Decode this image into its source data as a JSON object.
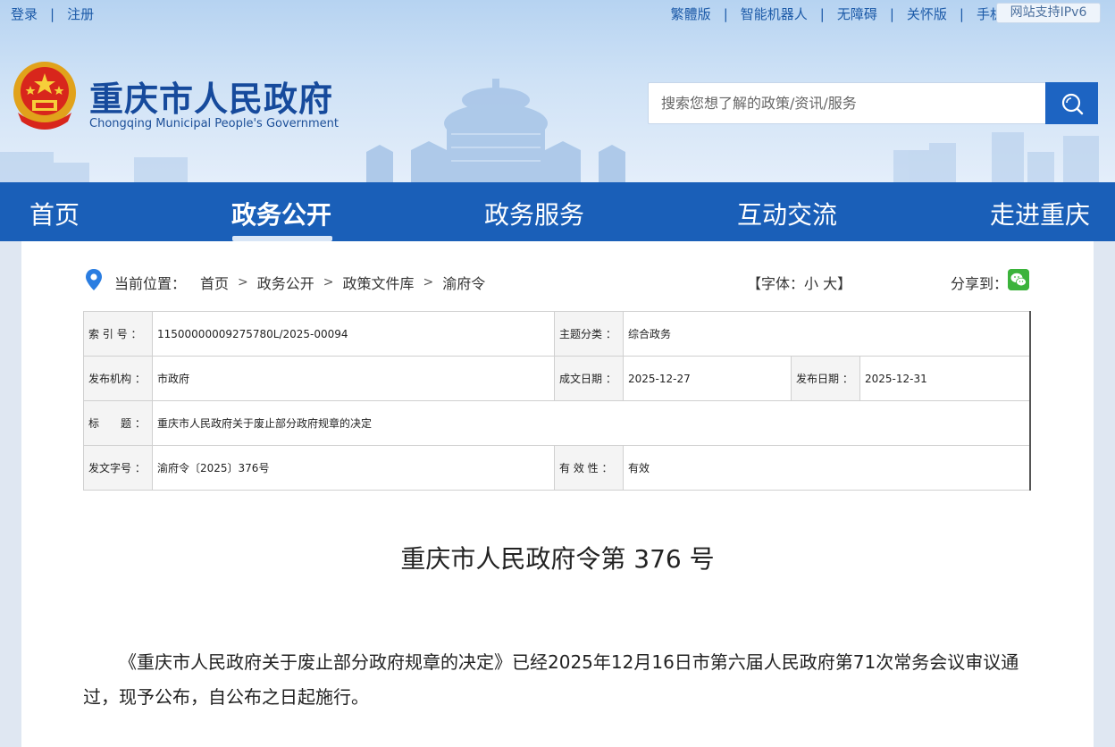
{
  "topbar": {
    "login": "登录",
    "register": "注册",
    "links": [
      "繁體版",
      "智能机器人",
      "无障碍",
      "关怀版",
      "手机版"
    ],
    "ipv6": "网站支持IPv6"
  },
  "brand": {
    "title": "重庆市人民政府",
    "subtitle": "Chongqing Municipal People's Government"
  },
  "search": {
    "placeholder": "搜索您想了解的政策/资讯/服务"
  },
  "nav": {
    "items": [
      "首页",
      "政务公开",
      "政务服务",
      "互动交流",
      "走进重庆"
    ],
    "active_index": 1
  },
  "breadcrumb": {
    "label": "当前位置：",
    "items": [
      "首页",
      "政务公开",
      "政策文件库",
      "渝府令"
    ]
  },
  "font_size": {
    "text": "【字体：小 大】"
  },
  "share": {
    "label": "分享到："
  },
  "info": {
    "index_no_label": "索 引 号 ：",
    "index_no": "11500000009275780L/2025-00094",
    "topic_label": "主题分类 ：",
    "topic": "综合政务",
    "publisher_label": "发布机构 ：",
    "publisher": "市政府",
    "created_label": "成文日期 ：",
    "created": "2025-12-27",
    "published_label": "发布日期 ：",
    "published": "2025-12-31",
    "title_label": "标　　题 ：",
    "title": "重庆市人民政府关于废止部分政府规章的决定",
    "doc_no_label": "发文字号 ：",
    "doc_no": "渝府令〔2025〕376号",
    "validity_label": "有 效 性 ：",
    "validity": "有效"
  },
  "document": {
    "heading": "重庆市人民政府令第 376 号",
    "body": "《重庆市人民政府关于废止部分政府规章的决定》已经2025年12月16日市第六届人民政府第71次常务会议审议通过，现予公布，自公布之日起施行。"
  },
  "colors": {
    "nav_bg": "#1a5fb8",
    "brand_blue": "#164a9c",
    "search_button": "#1d64c2",
    "wechat_green": "#3bb33b"
  }
}
